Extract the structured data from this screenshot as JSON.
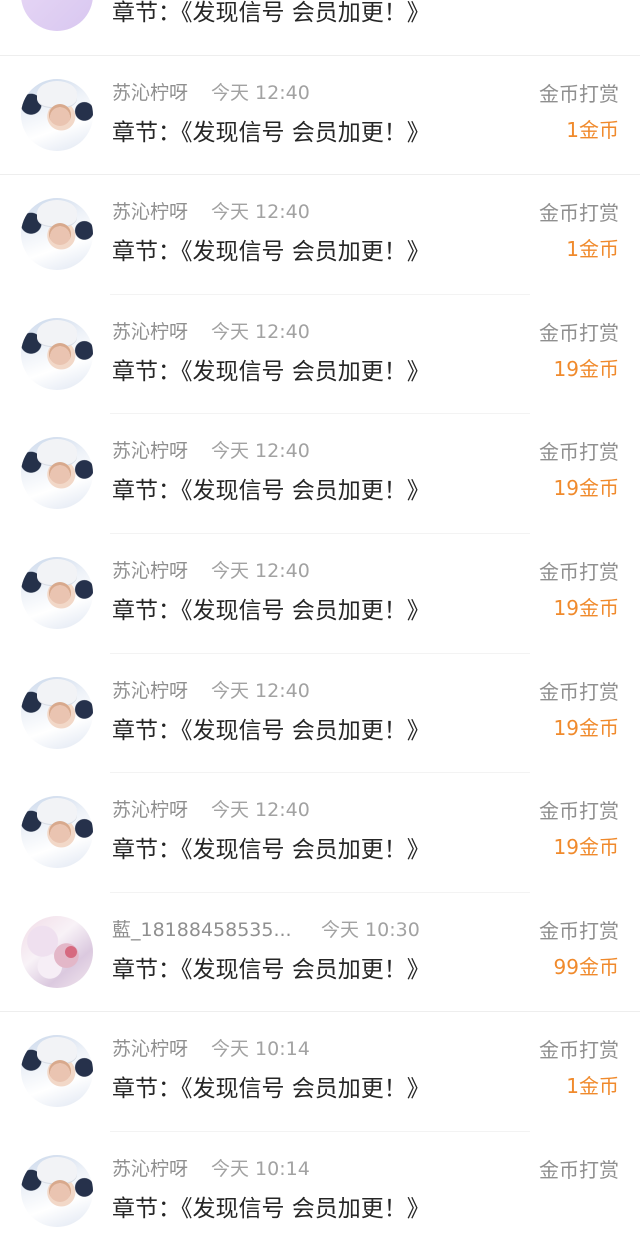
{
  "rows": [
    {
      "avatar": "lilac-avatar",
      "name": "",
      "time": "",
      "title": "章节：《发现信号 会员加更！》",
      "type": "",
      "amount": ""
    },
    {
      "avatar": "user-avatar",
      "name": "苏沁柠呀",
      "time": "今天 12:40",
      "title": "章节：《发现信号 会员加更！》",
      "type": "金币打赏",
      "amount": "1金币"
    },
    {
      "avatar": "user-avatar",
      "name": "苏沁柠呀",
      "time": "今天 12:40",
      "title": "章节：《发现信号 会员加更！》",
      "type": "金币打赏",
      "amount": "1金币"
    },
    {
      "avatar": "user-avatar",
      "name": "苏沁柠呀",
      "time": "今天 12:40",
      "title": "章节：《发现信号 会员加更！》",
      "type": "金币打赏",
      "amount": "19金币"
    },
    {
      "avatar": "user-avatar",
      "name": "苏沁柠呀",
      "time": "今天 12:40",
      "title": "章节：《发现信号 会员加更！》",
      "type": "金币打赏",
      "amount": "19金币"
    },
    {
      "avatar": "user-avatar",
      "name": "苏沁柠呀",
      "time": "今天 12:40",
      "title": "章节：《发现信号 会员加更！》",
      "type": "金币打赏",
      "amount": "19金币"
    },
    {
      "avatar": "user-avatar",
      "name": "苏沁柠呀",
      "time": "今天 12:40",
      "title": "章节：《发现信号 会员加更！》",
      "type": "金币打赏",
      "amount": "19金币"
    },
    {
      "avatar": "user-avatar",
      "name": "苏沁柠呀",
      "time": "今天 12:40",
      "title": "章节：《发现信号 会员加更！》",
      "type": "金币打赏",
      "amount": "19金币"
    },
    {
      "avatar": "pink-avatar",
      "name": "藍_18188458535...",
      "time": "今天 10:30",
      "title": "章节：《发现信号 会员加更！》",
      "type": "金币打赏",
      "amount": "99金币"
    },
    {
      "avatar": "user-avatar",
      "name": "苏沁柠呀",
      "time": "今天 10:14",
      "title": "章节：《发现信号 会员加更！》",
      "type": "金币打赏",
      "amount": "1金币"
    },
    {
      "avatar": "user-avatar",
      "name": "苏沁柠呀",
      "time": "今天 10:14",
      "title": "章节：《发现信号 会员加更！》",
      "type": "金币打赏",
      "amount": ""
    }
  ],
  "colors": {
    "amount": "#f08a2c",
    "meta": "#8f8f8f",
    "title": "#262626",
    "divider": "#eeeeee"
  }
}
